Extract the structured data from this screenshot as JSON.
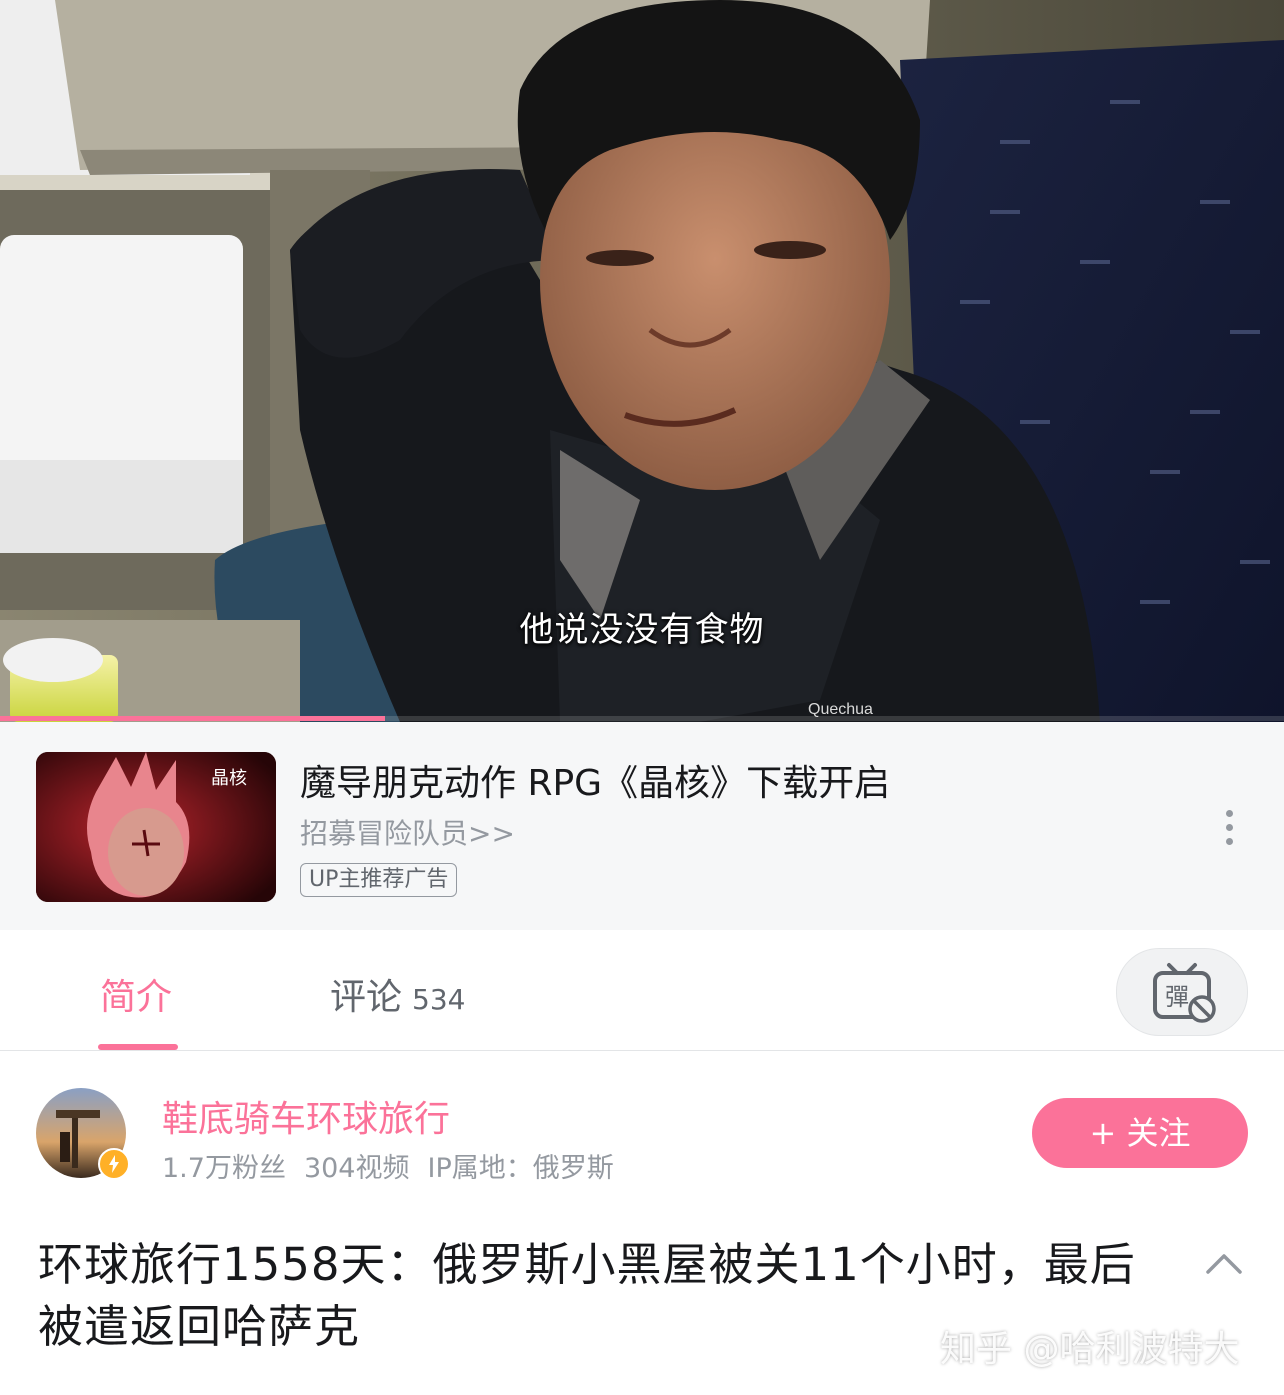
{
  "video": {
    "subtitle": "他说没没有食物",
    "progress_fraction": 0.3,
    "jacket_brand": "Quechua"
  },
  "ad": {
    "title": "魔导朋克动作 RPG《晶核》下载开启",
    "subtitle": "招募冒险队员>>",
    "tag": "UP主推荐广告",
    "thumb_logo": "晶核"
  },
  "tabs": {
    "intro_label": "简介",
    "comments_label": "评论",
    "comments_count": "534",
    "danmaku_icon": "danmaku-toggle-icon"
  },
  "uploader": {
    "name": "鞋底骑车环球旅行",
    "followers": "1.7万粉丝",
    "videos": "304视频",
    "ip_location": "IP属地：俄罗斯",
    "follow_label": "+ 关注"
  },
  "title": "环球旅行1558天：俄罗斯小黑屋被关11个小时，最后被遣返回哈萨克",
  "watermark": "知乎 @哈利波特大",
  "colors": {
    "accent": "#fb7299",
    "text_primary": "#18191c",
    "text_secondary": "#9499a0"
  }
}
